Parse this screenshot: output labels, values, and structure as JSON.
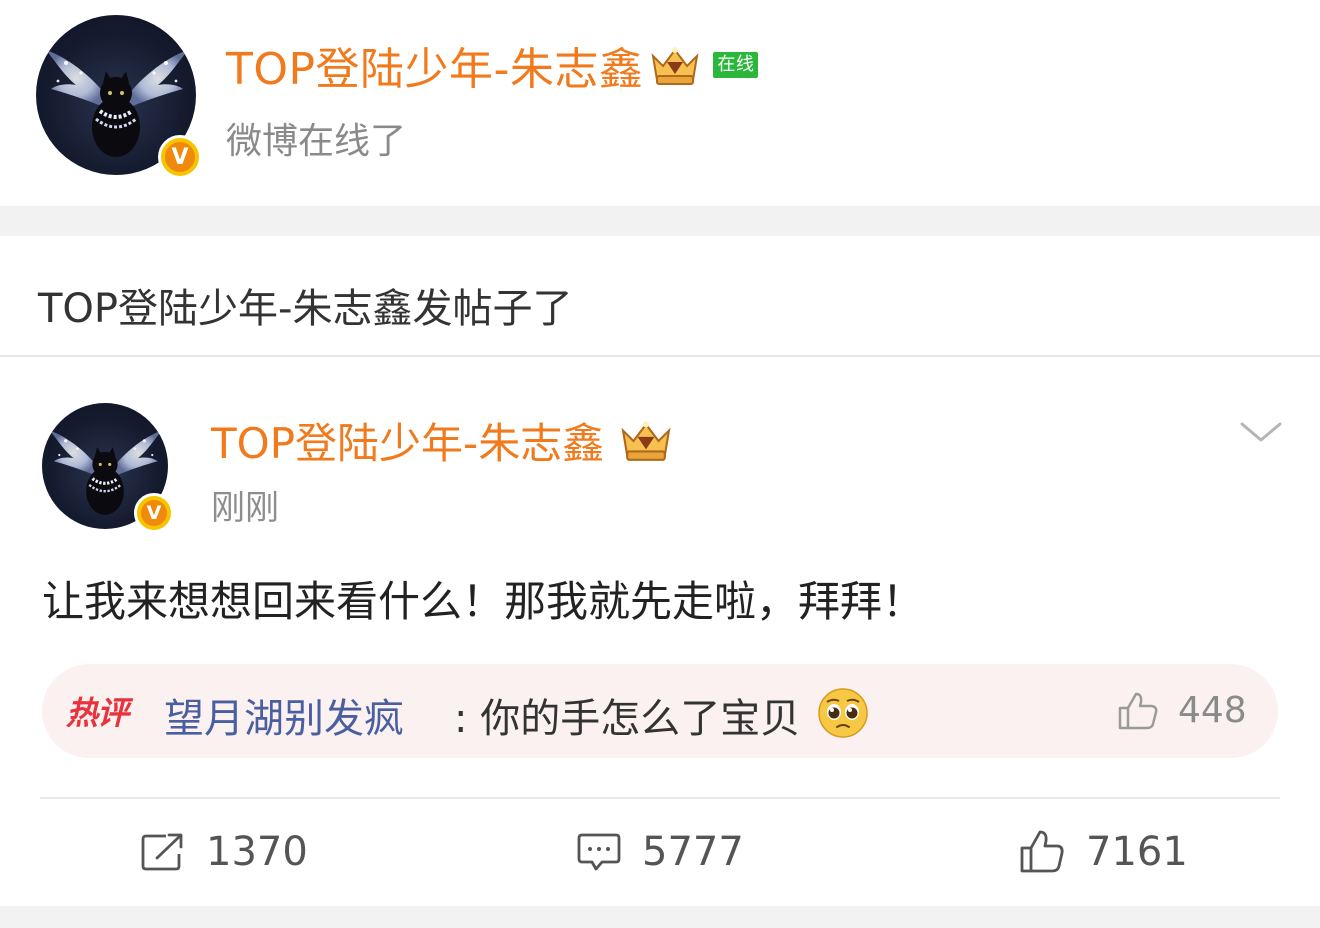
{
  "online_card": {
    "name": "TOP登陆少年-朱志鑫",
    "online_tag": "在线",
    "subtitle": "微博在线了",
    "verified_icon": "v-verified-badge",
    "crown_icon": "crown-member-icon"
  },
  "notice": {
    "text": "TOP登陆少年-朱志鑫发帖子了"
  },
  "post": {
    "author": "TOP登陆少年-朱志鑫",
    "time": "刚刚",
    "body": "让我来想想回来看什么！那我就先走啦，拜拜！",
    "menu_icon": "chevron-down-icon"
  },
  "hot_comment": {
    "tag": "热评",
    "user": "望月湖别发疯",
    "text": ": 你的手怎么了宝贝",
    "emoji": "pleading-face-emoji",
    "like_count": "448"
  },
  "actions": {
    "repost_count": "1370",
    "comment_count": "5777",
    "like_count": "7161"
  },
  "colors": {
    "name_orange": "#f07a1c",
    "online_green": "#2bb73b",
    "hot_red": "#e8323c",
    "comment_user_blue": "#4a5fa0",
    "pill_bg": "#fbf1f1",
    "band_gray": "#f2f2f2"
  }
}
